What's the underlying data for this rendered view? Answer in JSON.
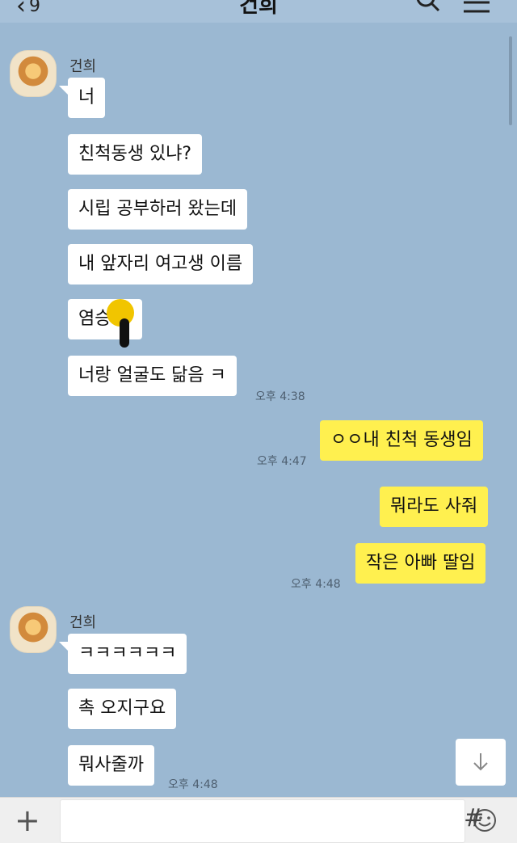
{
  "header": {
    "back_count": "9",
    "title": "건희"
  },
  "messages_group1": {
    "sender_name": "건희",
    "lines": [
      "너",
      "친척동생 있냐?",
      "시립 공부하러 왔는데",
      "내 앞자리 여고생 이름",
      "염승",
      "너랑 얼굴도 닮음 ㅋ"
    ],
    "time": "오후 4:38"
  },
  "messages_mine": {
    "lines": [
      "ㅇㅇ내 친척 동생임",
      "뭐라도 사줘",
      "작은 아빠 딸임"
    ],
    "time1": "오후 4:47",
    "time2": "오후 4:48"
  },
  "messages_group2": {
    "sender_name": "건희",
    "lines": [
      "ㅋㅋㅋㅋㅋㅋ",
      "촉 오지구요",
      "뭐사줄까"
    ],
    "time": "오후 4:48"
  },
  "icons": {
    "back": "chevron-left-icon",
    "search": "search-icon",
    "menu": "hamburger-menu-icon",
    "scroll_down": "arrow-down-icon",
    "plus": "plus-icon",
    "emoji": "smiley-icon",
    "hash": "hash-icon"
  },
  "colors": {
    "chat_background": "#9bb8d2",
    "my_bubble": "#fff04f",
    "their_bubble": "#ffffff"
  }
}
